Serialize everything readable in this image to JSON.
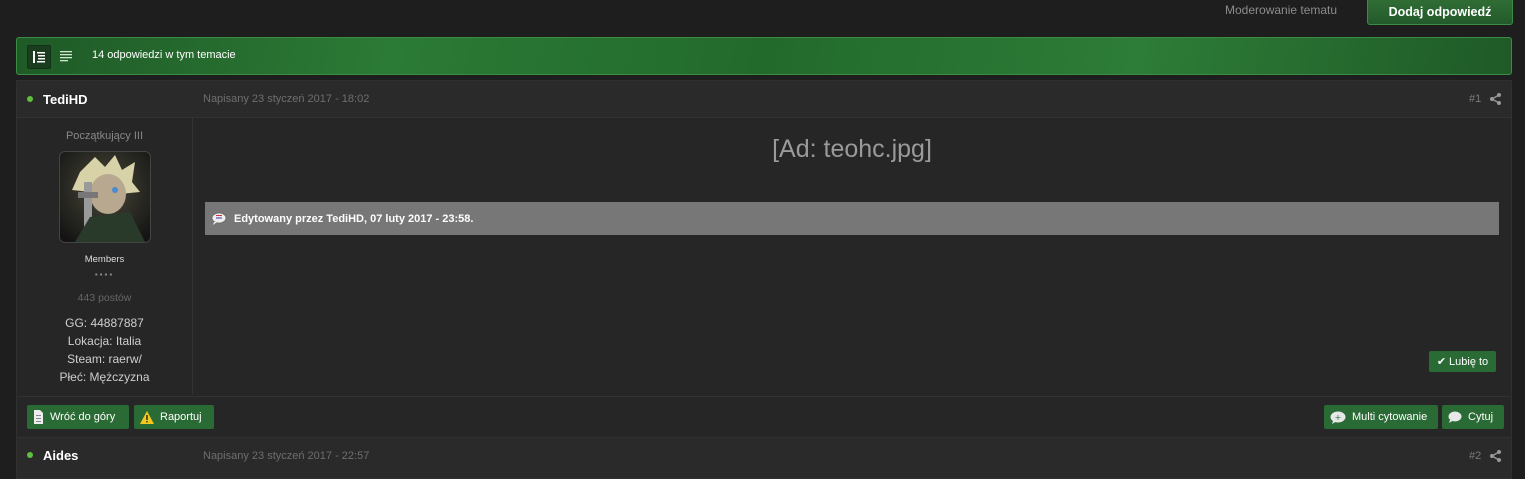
{
  "topbar": {
    "moderate_label": "Moderowanie tematu",
    "reply_label": "Dodaj odpowiedź"
  },
  "strip": {
    "replies_text": "14 odpowiedzi w tym temacie",
    "view_icons": [
      "threaded-view-icon",
      "list-view-icon"
    ]
  },
  "post1": {
    "author": "TediHD",
    "date": "Napisany 23 styczeń 2017 - 18:02",
    "number": "#1",
    "rank": "Początkujący III",
    "group": "Members",
    "pips": "▪▪▪▪",
    "post_count": "443 postów",
    "fields": [
      "GG: 44887887",
      "Lokacja: Italia",
      "Steam: raerw/",
      "Płeć: Mężczyzna"
    ],
    "ad_text": "[Ad: teohc.jpg]",
    "edit_text": "Edytowany przez TediHD, 07 luty 2017 - 23:58.",
    "like_label": "Lubię to",
    "footer": {
      "top_label": "Wróć do góry",
      "report_label": "Raportuj",
      "multiquote_label": "Multi cytowanie",
      "quote_label": "Cytuj"
    }
  },
  "post2": {
    "author": "Aides",
    "date": "Napisany 23 styczeń 2017 - 22:57",
    "number": "#2"
  },
  "colors": {
    "accent_green": "#2a6a34",
    "online_dot": "#5fbf3f",
    "edit_bar": "#777777"
  }
}
